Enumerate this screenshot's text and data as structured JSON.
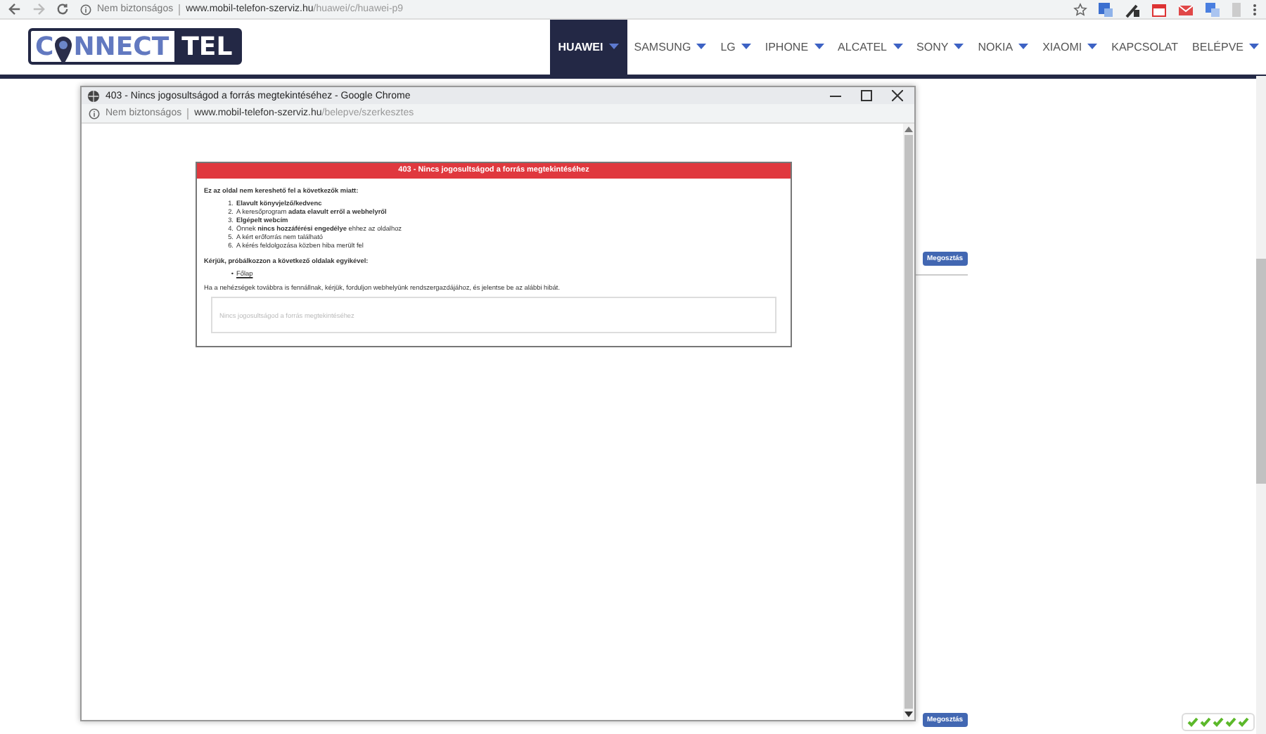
{
  "browser": {
    "security": "Nem biztonságos",
    "url_host": "www.mobil-telefon-szerviz.hu",
    "url_path": "/huawei/c/huawei-p9"
  },
  "site": {
    "logo_left": "C",
    "logo_mid": "NNECT",
    "logo_right": "TEL",
    "nav": [
      {
        "label": "HUAWEI",
        "selected": true,
        "dropdown": true
      },
      {
        "label": "SAMSUNG",
        "selected": false,
        "dropdown": true
      },
      {
        "label": "LG",
        "selected": false,
        "dropdown": true
      },
      {
        "label": "IPHONE",
        "selected": false,
        "dropdown": true
      },
      {
        "label": "ALCATEL",
        "selected": false,
        "dropdown": true
      },
      {
        "label": "SONY",
        "selected": false,
        "dropdown": true
      },
      {
        "label": "NOKIA",
        "selected": false,
        "dropdown": true
      },
      {
        "label": "XIAOMI",
        "selected": false,
        "dropdown": true
      },
      {
        "label": "KAPCSOLAT",
        "selected": false,
        "dropdown": false
      },
      {
        "label": "BELÉPVE",
        "selected": false,
        "dropdown": true
      }
    ],
    "share_buttons": [
      "Megosztás",
      "Megosztás"
    ]
  },
  "popup": {
    "title": "403 - Nincs jogosultságod a forrás megtekintéséhez - Google Chrome",
    "security": "Nem biztonságos",
    "url_host": "www.mobil-telefon-szerviz.hu",
    "url_path": "/belepve/szerkesztes",
    "error": {
      "heading": "403 - Nincs jogosultságod a forrás megtekintéséhez",
      "intro": "Ez az oldal nem kereshető fel a következők miatt:",
      "reasons": [
        {
          "marker": "1.",
          "text": "**Elavult könyvjelző/kedvenc**"
        },
        {
          "marker": "2.",
          "text": "A keresőprogram **adata elavult erről a webhelyről**"
        },
        {
          "marker": "3.",
          "text": "**Elgépelt webcím**"
        },
        {
          "marker": "4.",
          "text": "Önnek **nincs hozzáférési engedélye** ehhez az oldalhoz"
        },
        {
          "marker": "5.",
          "text": "A kért erőforrás nem található"
        },
        {
          "marker": "6.",
          "text": "A kérés feldolgozása közben hiba merült fel"
        }
      ],
      "link_marker": "•",
      "try_label": "Kérjük, próbálkozzon a következő oldalak egyikével:",
      "links": [
        "Főlap"
      ],
      "note": "Ha a nehézségek továbbra is fennállnak, kérjük, forduljon webhelyünk rendszergazdájához, és jelentse be az alábbi hibát.",
      "detail": "Nincs jogosultságod a forrás megtekintéséhez"
    }
  }
}
